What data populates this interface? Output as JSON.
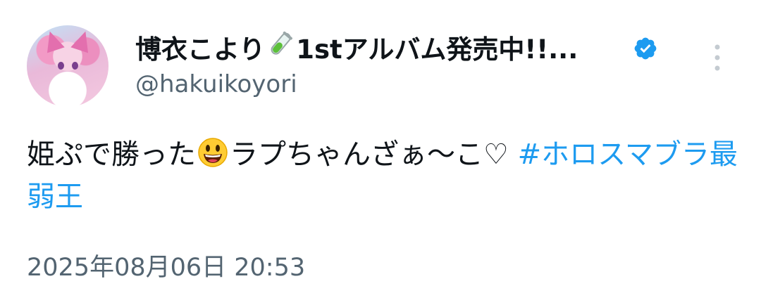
{
  "author": {
    "display_name_prefix": "博衣こより",
    "display_name_suffix": "1stアルバム発売中!!...",
    "handle": "@hakuikoyori",
    "verified_color": "#1d9bf0"
  },
  "tweet": {
    "text_before_emoji": "姫ぷで勝った",
    "text_after_emoji": "ラプちゃんざぁ〜こ♡ ",
    "hashtag": "#ホロスマブラ最弱王",
    "hashtag_color": "#1d9bf0"
  },
  "timestamp": "2025年08月06日 20:53",
  "icons": {
    "name_emoji": "test-tube-icon",
    "verified": "verified-badge-icon",
    "more": "more-vertical-icon",
    "tweet_emoji": "grinning-face-icon"
  }
}
